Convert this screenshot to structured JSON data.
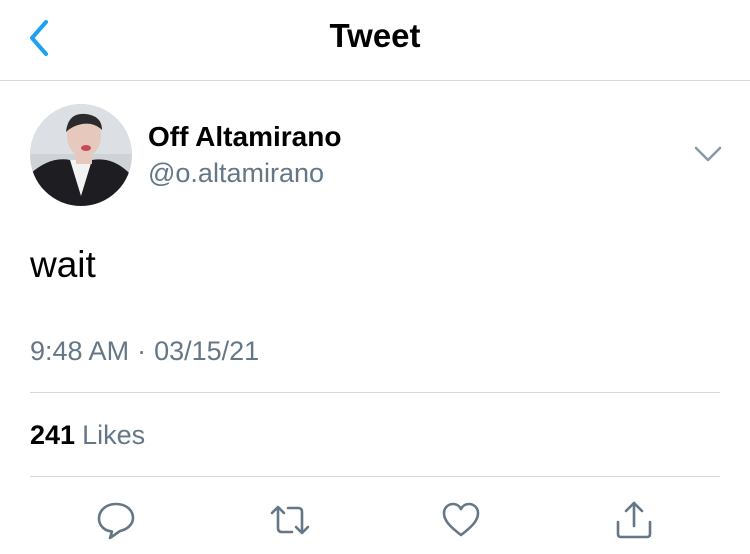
{
  "header": {
    "title": "Tweet",
    "back_icon": "chevron-left-icon",
    "accent": "#1da1f2"
  },
  "tweet": {
    "author_name": "Off Altamirano",
    "author_handle": "@o.altamirano",
    "text": "wait",
    "time": "9:48 AM",
    "separator": "·",
    "date": "03/15/21",
    "menu_icon": "chevron-down-icon"
  },
  "stats": {
    "likes_count": "241",
    "likes_label": "Likes"
  },
  "actions": [
    {
      "name": "reply",
      "icon": "reply-icon"
    },
    {
      "name": "retweet",
      "icon": "retweet-icon"
    },
    {
      "name": "like",
      "icon": "heart-icon"
    },
    {
      "name": "share",
      "icon": "share-icon"
    }
  ],
  "colors": {
    "text": "#14171a",
    "secondary": "#657786",
    "divider": "#d6d9db",
    "icon": "#657786"
  }
}
